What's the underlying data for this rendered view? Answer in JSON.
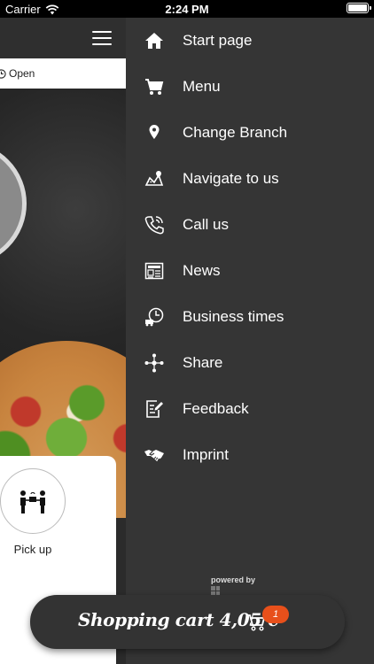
{
  "status_bar": {
    "carrier": "Carrier",
    "time": "2:24 PM"
  },
  "main": {
    "open_status": "Open",
    "pickup_label": "Pick up"
  },
  "menu": {
    "items": [
      {
        "label": "Start page",
        "icon": "home-icon"
      },
      {
        "label": "Menu",
        "icon": "cart-icon"
      },
      {
        "label": "Change Branch",
        "icon": "location-pin-icon"
      },
      {
        "label": "Navigate to us",
        "icon": "map-route-icon"
      },
      {
        "label": "Call us",
        "icon": "phone-icon"
      },
      {
        "label": "News",
        "icon": "newspaper-icon"
      },
      {
        "label": "Business times",
        "icon": "clock-truck-icon"
      },
      {
        "label": "Share",
        "icon": "share-icon"
      },
      {
        "label": "Feedback",
        "icon": "feedback-icon"
      },
      {
        "label": "Imprint",
        "icon": "handshake-icon"
      }
    ],
    "powered_by": "powered by"
  },
  "cart": {
    "label": "Shopping cart 4,05 €",
    "badge": "1"
  },
  "colors": {
    "menu_bg": "#353535",
    "cart_bg": "#333333",
    "badge": "#e8501b"
  }
}
